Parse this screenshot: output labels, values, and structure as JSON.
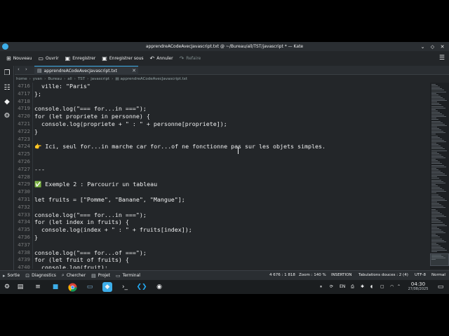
{
  "window": {
    "title": "apprendreACodeAvecJavascript.txt @ ~/Bureau/all/TST/javascript * — Kate"
  },
  "toolbar": {
    "new_label": "Nouveau",
    "open_label": "Ouvrir",
    "save_label": "Enregistrer",
    "save_as_label": "Enregistrer sous",
    "undo_label": "Annuler",
    "redo_label": "Refaire"
  },
  "tab": {
    "label": "apprendreACodeAvecJavascript.txt"
  },
  "breadcrumb": [
    "home",
    "yvan",
    "Bureau",
    "all",
    "TST",
    "javascript",
    "apprendreACodeAvecJavascript.txt"
  ],
  "editor": {
    "lines": [
      {
        "n": "4716",
        "text": "  ville: \"Paris\""
      },
      {
        "n": "4717",
        "text": "};"
      },
      {
        "n": "4718",
        "text": ""
      },
      {
        "n": "4719",
        "text": "console.log(\"=== for...in ===\");"
      },
      {
        "n": "4720",
        "text": "for (let propriete in personne) {"
      },
      {
        "n": "4721",
        "text": "  console.log(propriete + \" : \" + personne[propriete]);"
      },
      {
        "n": "4722",
        "text": "}"
      },
      {
        "n": "4723",
        "text": ""
      },
      {
        "n": "4724",
        "text": "👉 Ici, seul for...in marche car for...of ne fonctionne pas sur les objets simples."
      },
      {
        "n": "4725",
        "text": ""
      },
      {
        "n": "4726",
        "text": ""
      },
      {
        "n": "4727",
        "text": "---"
      },
      {
        "n": "4728",
        "text": ""
      },
      {
        "n": "4729",
        "text": "✅ Exemple 2 : Parcourir un tableau"
      },
      {
        "n": "4730",
        "text": ""
      },
      {
        "n": "4731",
        "text": "let fruits = [\"Pomme\", \"Banane\", \"Mangue\"];"
      },
      {
        "n": "4732",
        "text": ""
      },
      {
        "n": "4733",
        "text": "console.log(\"=== for...in ===\");"
      },
      {
        "n": "4734",
        "text": "for (let index in fruits) {"
      },
      {
        "n": "4735",
        "text": "  console.log(index + \" : \" + fruits[index]);"
      },
      {
        "n": "4736",
        "text": "}"
      },
      {
        "n": "4737",
        "text": ""
      },
      {
        "n": "4738",
        "text": "console.log(\"=== for...of ===\");"
      },
      {
        "n": "4739",
        "text": "for (let fruit of fruits) {"
      },
      {
        "n": "4740",
        "text": "  console.log(fruit);"
      }
    ]
  },
  "bottombar": {
    "output_label": "Sortie",
    "diagnostics_label": "Diagnostics",
    "search_label": "Chercher",
    "project_label": "Projet",
    "terminal_label": "Terminal"
  },
  "status": {
    "position": "4 676 : 1 818",
    "zoom": "Zoom : 140 %",
    "mode": "INSERTION",
    "tabs": "Tabulations douces : 2 (4)",
    "encoding": "UTF-8",
    "syntax": "Normal"
  },
  "taskbar": {
    "time": "04:30",
    "date": "27/08/2025",
    "lang": "EN"
  },
  "colors": {
    "background": "#232629",
    "accent": "#3daee9",
    "text": "#eff0f1"
  }
}
